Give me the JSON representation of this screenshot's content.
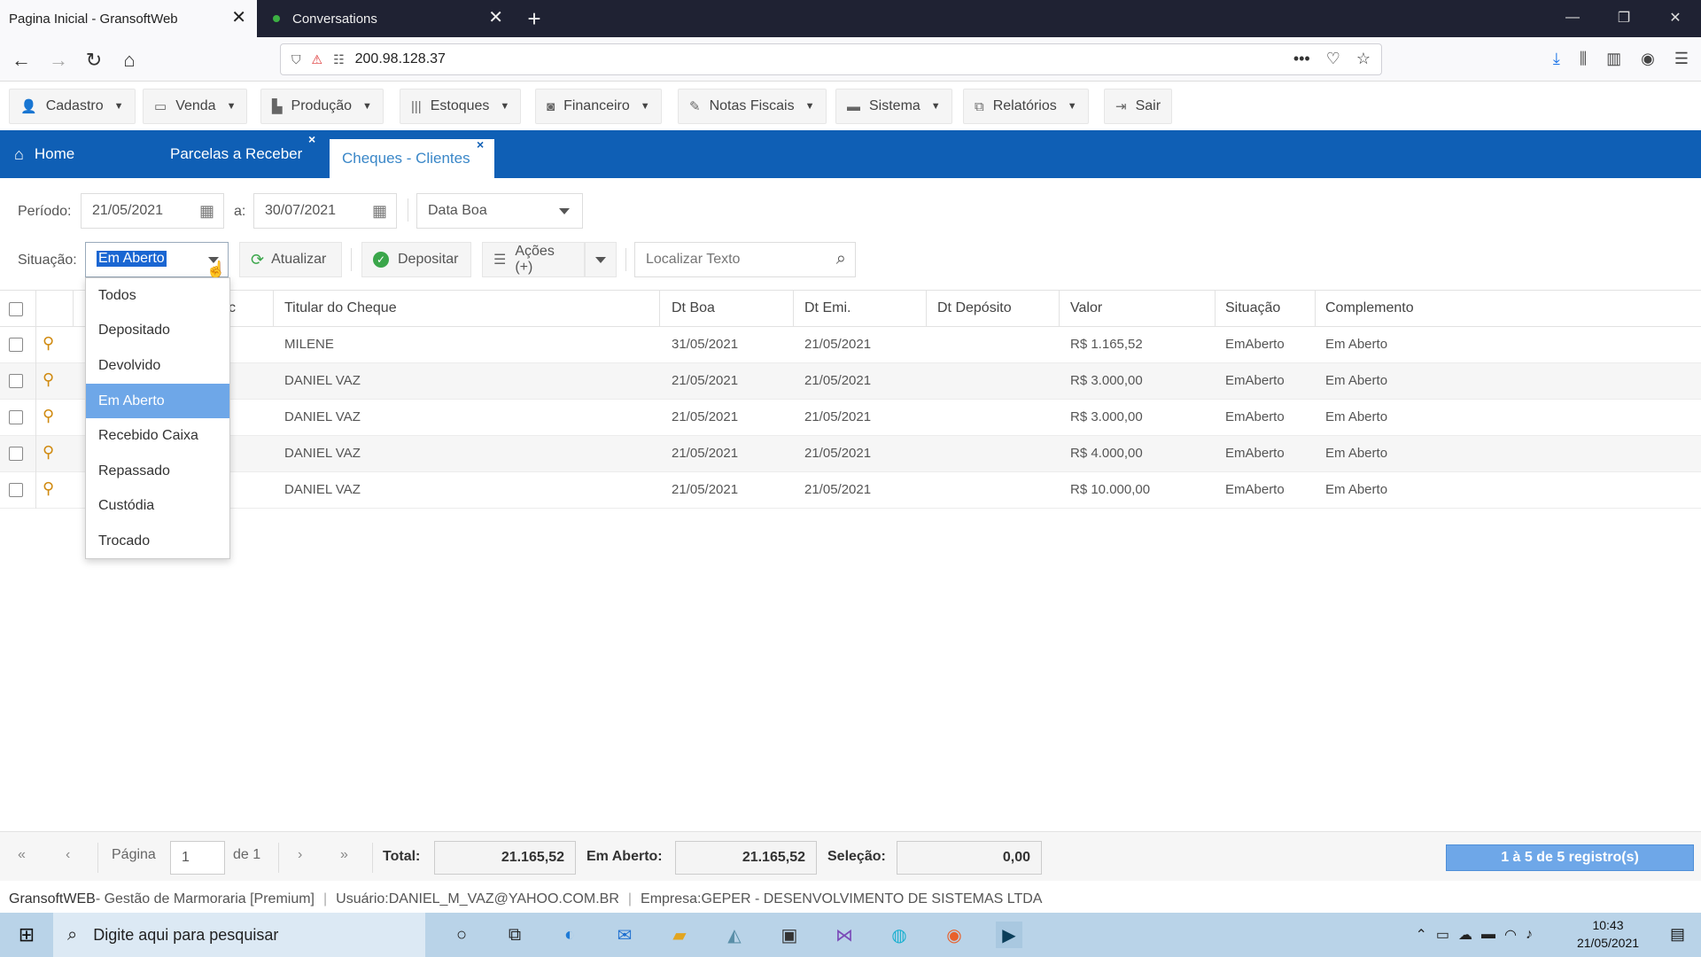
{
  "browser": {
    "tabs": [
      {
        "title": "Pagina Inicial - GransoftWeb",
        "active": true
      },
      {
        "title": "Conversations",
        "active": false
      }
    ],
    "url": "200.98.128.37"
  },
  "menu": [
    {
      "label": "Cadastro",
      "icon": "user-icon"
    },
    {
      "label": "Venda",
      "icon": "card-icon"
    },
    {
      "label": "Produção",
      "icon": "chart-icon"
    },
    {
      "label": "Estoques",
      "icon": "barcode-icon"
    },
    {
      "label": "Financeiro",
      "icon": "money-icon"
    },
    {
      "label": "Notas Fiscais",
      "icon": "edit-icon"
    },
    {
      "label": "Sistema",
      "icon": "laptop-icon"
    },
    {
      "label": "Relatórios",
      "icon": "copy-icon"
    },
    {
      "label": "Sair",
      "icon": "exit-icon"
    }
  ],
  "app_tabs": {
    "home": "Home",
    "tab1": "Parcelas a Receber",
    "tab2": "Cheques - Clientes",
    "close": "×"
  },
  "filters": {
    "periodo_label": "Período:",
    "date_from": "21/05/2021",
    "a_label": "a:",
    "date_to": "30/07/2021",
    "date_type": "Data Boa",
    "situacao_label": "Situação:",
    "situacao_value": "Em Aberto",
    "atualizar": "Atualizar",
    "depositar": "Depositar",
    "acoes": "Ações (+)",
    "search_placeholder": "Localizar Texto"
  },
  "dropdown_options": [
    "Todos",
    "Depositado",
    "Devolvido",
    "Em Aberto",
    "Recebido Caixa",
    "Repassado",
    "Custódia",
    "Trocado"
  ],
  "dropdown_selected": 3,
  "grid": {
    "columns": {
      "c_partial": "c",
      "titular": "Titular do Cheque",
      "dt_boa": "Dt Boa",
      "dt_emi": "Dt Emi.",
      "dt_deposito": "Dt Depósito",
      "valor": "Valor",
      "situacao": "Situação",
      "complemento": "Complemento"
    },
    "rows": [
      {
        "titular": "MILENE",
        "dt_boa": "31/05/2021",
        "dt_emi": "21/05/2021",
        "dt_deposito": "",
        "valor": "R$ 1.165,52",
        "situacao": "EmAberto",
        "complemento": "Em Aberto"
      },
      {
        "titular": "DANIEL VAZ",
        "dt_boa": "21/05/2021",
        "dt_emi": "21/05/2021",
        "dt_deposito": "",
        "valor": "R$ 3.000,00",
        "situacao": "EmAberto",
        "complemento": "Em Aberto"
      },
      {
        "titular": "DANIEL VAZ",
        "dt_boa": "21/05/2021",
        "dt_emi": "21/05/2021",
        "dt_deposito": "",
        "valor": "R$ 3.000,00",
        "situacao": "EmAberto",
        "complemento": "Em Aberto"
      },
      {
        "titular": "DANIEL VAZ",
        "dt_boa": "21/05/2021",
        "dt_emi": "21/05/2021",
        "dt_deposito": "",
        "valor": "R$ 4.000,00",
        "situacao": "EmAberto",
        "complemento": "Em Aberto"
      },
      {
        "titular": "DANIEL VAZ",
        "dt_boa": "21/05/2021",
        "dt_emi": "21/05/2021",
        "dt_deposito": "",
        "valor": "R$ 10.000,00",
        "situacao": "EmAberto",
        "complemento": "Em Aberto"
      }
    ]
  },
  "pager": {
    "pagina_label": "Página",
    "page": "1",
    "de_label": "de 1",
    "total_label": "Total:",
    "total": "21.165,52",
    "aberto_label": "Em Aberto:",
    "aberto": "21.165,52",
    "selecao_label": "Seleção:",
    "selecao": "0,00",
    "records": "1 à 5 de 5 registro(s)"
  },
  "status": {
    "product_brand": "GransoftWEB",
    "product_rest": " - Gestão de Marmoraria [Premium]",
    "usuario": "Usuário:DANIEL_M_VAZ@YAHOO.COM.BR",
    "empresa": "Empresa:GEPER - DESENVOLVIMENTO DE SISTEMAS LTDA"
  },
  "taskbar": {
    "search_placeholder": "Digite aqui para pesquisar",
    "time": "10:43",
    "date": "21/05/2021"
  }
}
